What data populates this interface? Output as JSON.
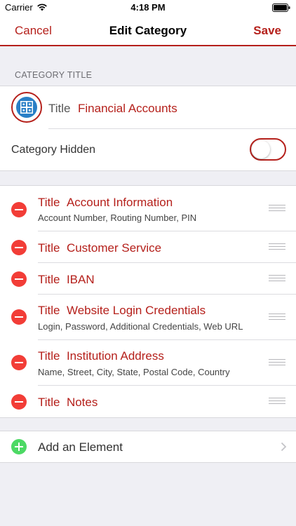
{
  "status_bar": {
    "carrier": "Carrier",
    "time": "4:18 PM"
  },
  "nav": {
    "cancel": "Cancel",
    "title": "Edit Category",
    "save": "Save"
  },
  "category": {
    "section_header": "CATEGORY TITLE",
    "title_label": "Title",
    "title_value": "Financial Accounts",
    "hidden_label": "Category Hidden",
    "hidden": false,
    "icon": "safe-icon"
  },
  "elements": [
    {
      "title_label": "Title",
      "title": "Account Information",
      "subtitle": "Account Number, Routing Number, PIN"
    },
    {
      "title_label": "Title",
      "title": "Customer Service",
      "subtitle": ""
    },
    {
      "title_label": "Title",
      "title": "IBAN",
      "subtitle": ""
    },
    {
      "title_label": "Title",
      "title": "Website Login Credentials",
      "subtitle": "Login, Password, Additional Credentials, Web URL"
    },
    {
      "title_label": "Title",
      "title": "Institution Address",
      "subtitle": "Name, Street, City, State, Postal Code, Country"
    },
    {
      "title_label": "Title",
      "title": "Notes",
      "subtitle": ""
    }
  ],
  "add_element": {
    "label": "Add an Element"
  },
  "colors": {
    "accent": "#b5201b",
    "delete": "#f23d37",
    "add": "#4cd964",
    "background": "#efeff4"
  }
}
